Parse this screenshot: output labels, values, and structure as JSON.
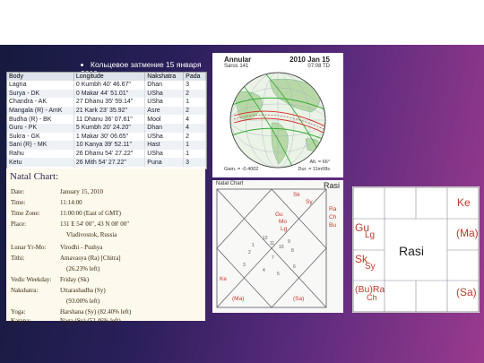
{
  "slide": {
    "bullet": "Кольцевое затмение 15 января 2010"
  },
  "planet_table": {
    "headers": [
      "Body",
      "Longitude",
      "Nakshatra",
      "Pada"
    ],
    "rows": [
      [
        "Lagna",
        "0 Kumbh 40' 46.67\"",
        "Dhan",
        "3"
      ],
      [
        "Surya - DK",
        "0 Makar 44' 51.01\"",
        "USha",
        "2"
      ],
      [
        "Chandra - AK",
        "27 Dhanu 35' 59.14\"",
        "USha",
        "1"
      ],
      [
        "Mangala (R) - AmK",
        "21 Kark 23' 35.92\"",
        "Asre",
        "2"
      ],
      [
        "Budha (R) - BK",
        "11 Dhanu 36' 07.61\"",
        "Mool",
        "4"
      ],
      [
        "Guru - PK",
        "5 Kumbh 20' 24.20\"",
        "Dhan",
        "4"
      ],
      [
        "Sukra - GK",
        "1 Makar 30' 06.65\"",
        "USha",
        "2"
      ],
      [
        "Sani (R) - MK",
        "10 Kanya 39' 52.11\"",
        "Hast",
        "1"
      ],
      [
        "Rahu",
        "26 Dhanu 54' 27.22\"",
        "USha",
        "1"
      ],
      [
        "Ketu",
        "26 Mith 54' 27.22\"",
        "Puna",
        "3"
      ]
    ]
  },
  "natal": {
    "title": "Natal Chart:",
    "rows": [
      {
        "k": "Date:",
        "v": "January 15, 2010"
      },
      {
        "k": "Time:",
        "v": "11:14:00"
      },
      {
        "k": "Time Zone:",
        "v": "11:00:00 (East of GMT)"
      },
      {
        "k": "Place:",
        "v": "131 E 54' 00\", 43 N 08' 00\""
      },
      {
        "k": "",
        "v": "Vladivostok, Russia"
      },
      {
        "k": "Lunar Yr-Mo:",
        "v": "Virodhi - Pushya"
      },
      {
        "k": "Tithi:",
        "v": "Amavasya (Ra) [Chitra]"
      },
      {
        "k": "",
        "v": "(26.23% left)"
      },
      {
        "k": "Vedic Weekday:",
        "v": "Friday (Sk)"
      },
      {
        "k": "Nakshatra:",
        "v": "Uttarashadha (Sy)"
      },
      {
        "k": "",
        "v": "(93.00% left)"
      },
      {
        "k": "Yoga:",
        "v": "Harshana (Sy) (82.40% left)"
      },
      {
        "k": "Karana:",
        "v": "Naga (Sy) (52.46% left)"
      }
    ]
  },
  "eclipse_map": {
    "title_left": "Annular",
    "saros": "Saros 141",
    "title_right": "2010 Jan 15",
    "time": "07:08 TD",
    "gam": "Gam. = -0.4002",
    "alt": "Alt. = 66°",
    "dur": "Dur. = 11m08s"
  },
  "north_chart": {
    "title": "Natal Chart",
    "rasi": "Rasi",
    "planets": [
      "Gu",
      "Sk",
      "Sy",
      "Mo",
      "Lg",
      "Ra",
      "Ch",
      "Bu",
      "Ke",
      "(Ma)",
      "(Sa)"
    ],
    "house_numbers": [
      "11",
      "10",
      "12",
      "9",
      "1",
      "8",
      "2",
      "7",
      "3",
      "6",
      "4",
      "5"
    ]
  },
  "south_chart": {
    "center": "Rasi",
    "planets": [
      "Gu",
      "Lg",
      "Ke",
      "(Ma)",
      "Sk",
      "Sy",
      "(Bu)Ra",
      "Ch",
      "(Sa)"
    ]
  },
  "colors": {
    "accent": "#c0392b",
    "bg_dark": "#141a3c",
    "bg_pink": "#9a3a8e"
  }
}
